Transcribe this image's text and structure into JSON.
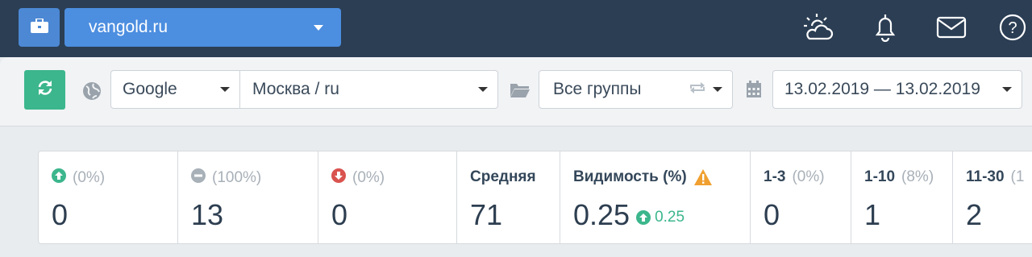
{
  "header": {
    "site": "vangold.ru",
    "icons": [
      "briefcase-icon",
      "weather-icon",
      "bell-icon",
      "mail-icon",
      "help-icon"
    ]
  },
  "toolbar": {
    "engine": "Google",
    "region": "Москва / ru",
    "groups": "Все группы",
    "dates": "13.02.2019 — 13.02.2019"
  },
  "stats": {
    "up": {
      "pct": "(0%)",
      "value": "0"
    },
    "same": {
      "pct": "(100%)",
      "value": "13"
    },
    "down": {
      "pct": "(0%)",
      "value": "0"
    },
    "avg": {
      "label": "Средняя",
      "value": "71"
    },
    "visibility": {
      "label": "Видимость (%)",
      "value": "0.25",
      "delta": "0.25"
    },
    "top3": {
      "label": "1-3",
      "pct": "(0%)",
      "value": "0"
    },
    "top10": {
      "label": "1-10",
      "pct": "(8%)",
      "value": "1"
    },
    "top30": {
      "label": "11-30",
      "pct": "(1",
      "value": "2"
    }
  },
  "colors": {
    "navbar": "#2b3e54",
    "accent_blue": "#4c8ee0",
    "green": "#3cb68c",
    "red": "#d9534f",
    "warning": "#f0a030"
  }
}
